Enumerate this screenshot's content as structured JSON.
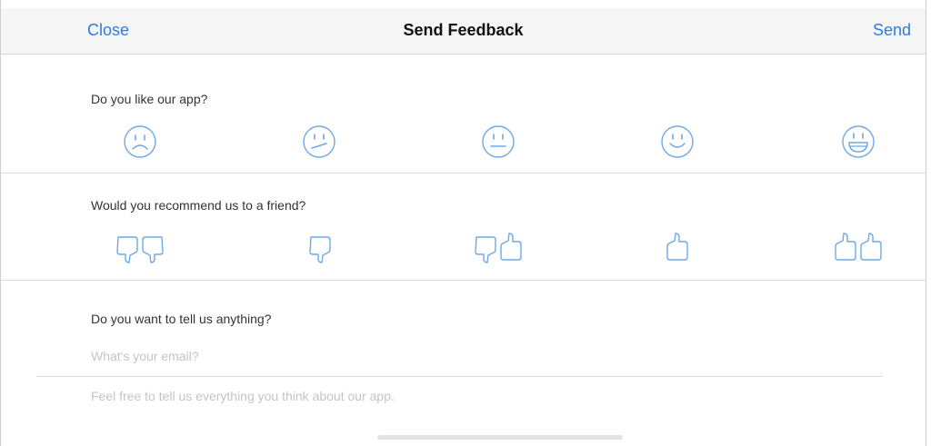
{
  "navbar": {
    "close_label": "Close",
    "title": "Send Feedback",
    "send_label": "Send"
  },
  "like_section": {
    "question": "Do you like our app?",
    "options": [
      "very-sad-face-icon",
      "unsure-face-icon",
      "neutral-face-icon",
      "smile-face-icon",
      "laughing-face-icon"
    ]
  },
  "recommend_section": {
    "question": "Would you recommend us to a friend?",
    "options": [
      "two-thumbs-down-icon",
      "thumb-down-icon",
      "thumbs-down-up-icon",
      "thumb-up-icon",
      "two-thumbs-up-icon"
    ]
  },
  "message_section": {
    "question": "Do you want to tell us anything?",
    "email_placeholder": "What's your email?",
    "message_placeholder": "Feel free to tell us everything you think about our app."
  },
  "colors": {
    "accent": "#2f7be0",
    "icon_stroke": "#6fa8e6",
    "divider": "#dcdcdc"
  }
}
